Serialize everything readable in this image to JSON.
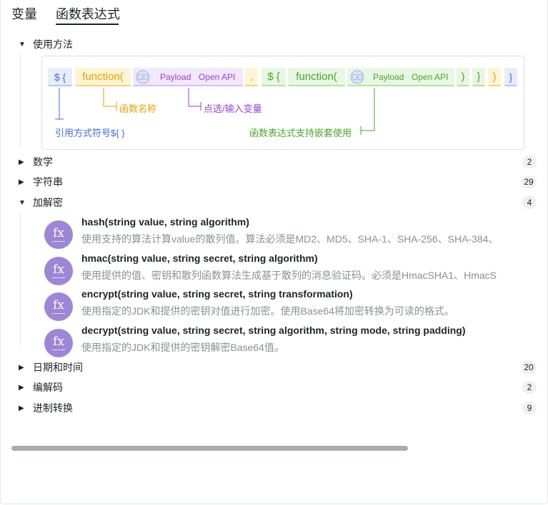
{
  "tabs": [
    {
      "label": "变量",
      "active": false
    },
    {
      "label": "函数表达式",
      "active": true
    }
  ],
  "usage": {
    "title": "使用方法",
    "tokens": {
      "dollar_brace": "$ {",
      "function": "function(",
      "payload": "Payload",
      "open_api": "Open API",
      "comma": ",",
      "dollar_brace_2": "$ {",
      "function_2": "function(",
      "payload_2": "Payload",
      "open_api_2": "Open API",
      "close_paren": ")",
      "close_brace": "}",
      "close_paren_2": ")",
      "close_brace_2": "}"
    },
    "annotations": {
      "function_name": "函数名称",
      "select_var": "点选/输入变量",
      "reference_symbol": "引用方式符号${ }",
      "nesting": "函数表达式支持嵌套使用"
    },
    "colors": {
      "blue": "#3d6be0",
      "yellow": "#e8a200",
      "purple": "#9b3fd9",
      "green": "#46a829"
    }
  },
  "categories": [
    {
      "label": "数学",
      "count": "2",
      "expanded": false
    },
    {
      "label": "字符串",
      "count": "29",
      "expanded": false
    },
    {
      "label": "加解密",
      "count": "4",
      "expanded": true
    },
    {
      "label": "日期和时间",
      "count": "20",
      "expanded": false
    },
    {
      "label": "编解码",
      "count": "2",
      "expanded": false
    },
    {
      "label": "进制转换",
      "count": "9",
      "expanded": false
    }
  ],
  "functions": [
    {
      "icon": "fx",
      "signature": "hash(string value, string algorithm)",
      "description": "使用支持的算法计算value的散列值。算法必须是MD2、MD5、SHA-1、SHA-256、SHA-384、"
    },
    {
      "icon": "fx",
      "signature": "hmac(string value, string secret, string algorithm)",
      "description": "使用提供的值、密钥和散列函数算法生成基于散列的消息验证码。必须是HmacSHA1、HmacS"
    },
    {
      "icon": "fx",
      "signature": "encrypt(string value, string secret, string transformation)",
      "description": "使用指定的JDK和提供的密钥对值进行加密。使用Base64将加密转换为可读的格式。"
    },
    {
      "icon": "fx",
      "signature": "decrypt(string value, string secret, string algorithm, string mode, string padding)",
      "description": "使用指定的JDK和提供的密钥解密Base64值。"
    }
  ]
}
